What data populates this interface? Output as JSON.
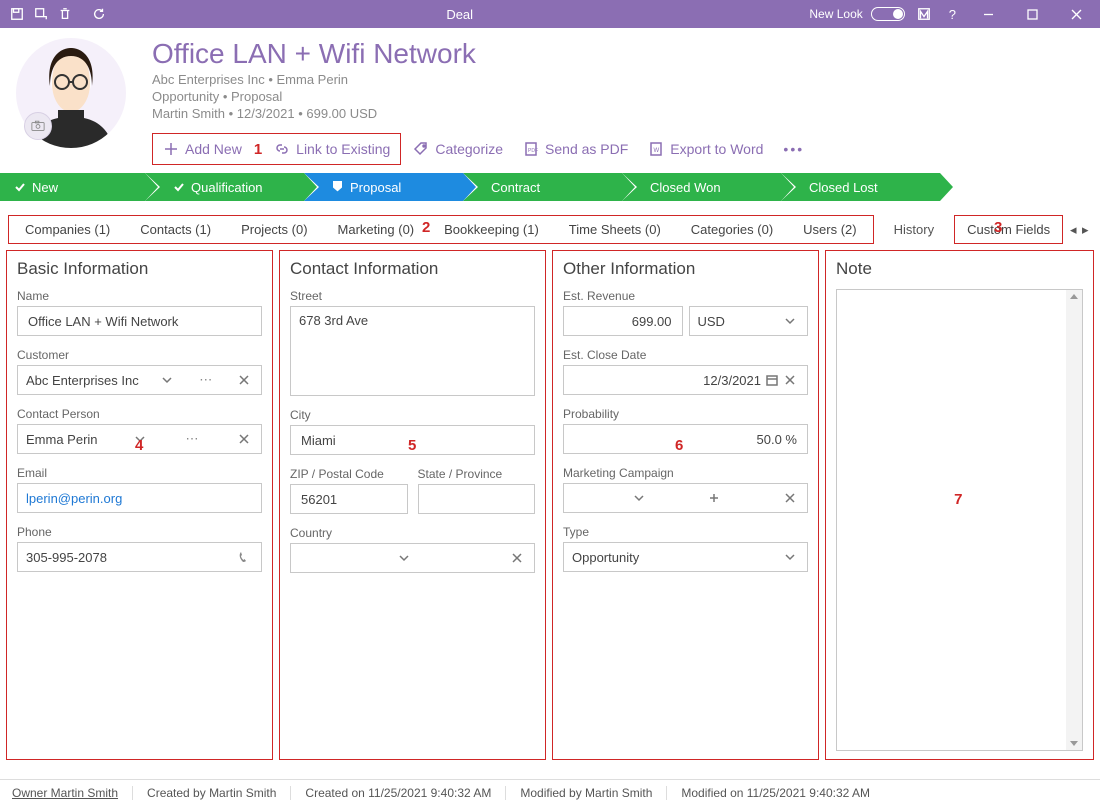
{
  "titlebar": {
    "title": "Deal",
    "newlook": "New Look"
  },
  "header": {
    "title": "Office LAN + Wifi Network",
    "company": "Abc Enterprises Inc",
    "dot": " • ",
    "contact": "Emma Perin",
    "type": "Opportunity",
    "stage": "Proposal",
    "owner": "Martin Smith",
    "date": "12/3/2021",
    "amount": "699.00 USD"
  },
  "actions": {
    "add": "Add New",
    "link": "Link to Existing",
    "cat": "Categorize",
    "pdf": "Send as PDF",
    "word": "Export to Word"
  },
  "stages": [
    "New",
    "Qualification",
    "Proposal",
    "Contract",
    "Closed Won",
    "Closed Lost"
  ],
  "tabs": {
    "items": [
      "Companies (1)",
      "Contacts (1)",
      "Projects (0)",
      "Marketing (0)",
      "Bookkeeping (1)",
      "Time Sheets (0)",
      "Categories (0)",
      "Users (2)"
    ],
    "history": "History",
    "custom": "Custom Fields"
  },
  "basic": {
    "title": "Basic Information",
    "name_label": "Name",
    "name": "Office LAN + Wifi Network",
    "customer_label": "Customer",
    "customer": "Abc Enterprises Inc",
    "contact_label": "Contact Person",
    "contact": "Emma Perin",
    "email_label": "Email",
    "email": "lperin@perin.org",
    "phone_label": "Phone",
    "phone": "305-995-2078"
  },
  "contactinfo": {
    "title": "Contact Information",
    "street_label": "Street",
    "street": "678 3rd Ave",
    "city_label": "City",
    "city": "Miami",
    "zip_label": "ZIP / Postal Code",
    "zip": "56201",
    "state_label": "State / Province",
    "state": "",
    "country_label": "Country",
    "country": ""
  },
  "other": {
    "title": "Other Information",
    "rev_label": "Est. Revenue",
    "rev": "699.00",
    "cur": "USD",
    "close_label": "Est. Close Date",
    "close": "12/3/2021",
    "prob_label": "Probability",
    "prob": "50.0 %",
    "camp_label": "Marketing Campaign",
    "camp": "",
    "type_label": "Type",
    "type": "Opportunity"
  },
  "note": {
    "title": "Note"
  },
  "status": {
    "owner": "Owner Martin Smith",
    "created_by": "Created by Martin Smith",
    "created_on": "Created on 11/25/2021 9:40:32 AM",
    "modified_by": "Modified by Martin Smith",
    "modified_on": "Modified on 11/25/2021 9:40:32 AM"
  },
  "annotations": {
    "a1": "1",
    "a2": "2",
    "a3": "3",
    "a4": "4",
    "a5": "5",
    "a6": "6",
    "a7": "7"
  }
}
